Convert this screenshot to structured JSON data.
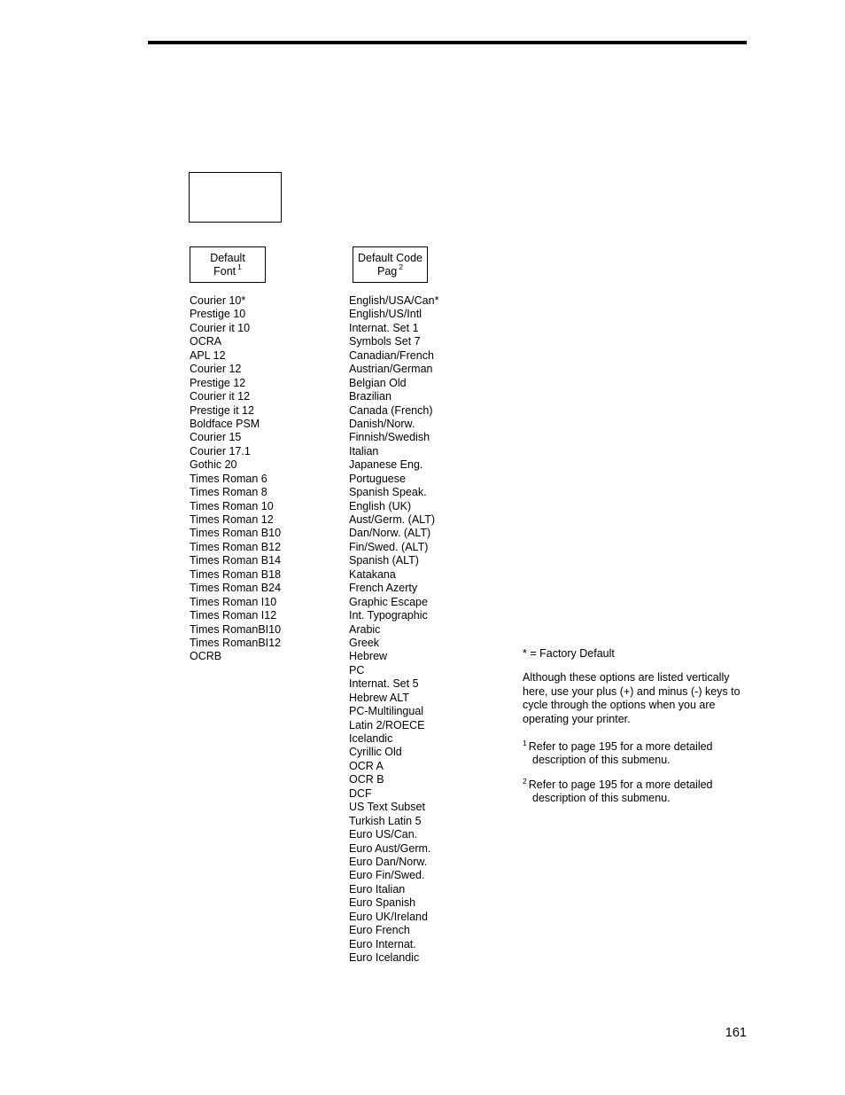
{
  "page": {
    "number": "161"
  },
  "menu_tree": {
    "parent_node": {
      "label": ""
    },
    "default_font_node": {
      "line1": "Default",
      "line2": "Font",
      "footnote_mark": "1"
    },
    "default_code_page_node": {
      "line1": "Default Code",
      "line2": "Pag",
      "footnote_mark": "2"
    }
  },
  "font_options": [
    "Courier 10*",
    "Prestige 10",
    "Courier it 10",
    "OCRA",
    "APL 12",
    "Courier 12",
    "Prestige 12",
    "Courier it 12",
    "Prestige it 12",
    "Boldface PSM",
    "Courier 15",
    "Courier 17.1",
    "Gothic 20",
    "Times Roman 6",
    "Times Roman 8",
    "Times Roman 10",
    "Times Roman 12",
    "Times Roman B10",
    "Times Roman B12",
    "Times Roman B14",
    "Times Roman B18",
    "Times Roman B24",
    "Times Roman I10",
    "Times Roman I12",
    "Times RomanBI10",
    "Times RomanBI12",
    "OCRB"
  ],
  "code_page_options": [
    "English/USA/Can*",
    "English/US/Intl",
    "Internat. Set 1",
    "Symbols Set 7",
    "Canadian/French",
    "Austrian/German",
    "Belgian Old",
    "Brazilian",
    "Canada (French)",
    "Danish/Norw.",
    "Finnish/Swedish",
    "Italian",
    "Japanese Eng.",
    "Portuguese",
    "Spanish Speak.",
    "English (UK)",
    "Aust/Germ. (ALT)",
    "Dan/Norw. (ALT)",
    "Fin/Swed. (ALT)",
    "Spanish (ALT)",
    "Katakana",
    "French Azerty",
    "Graphic Escape",
    "Int. Typographic",
    "Arabic",
    "Greek",
    "Hebrew",
    "PC",
    "Internat. Set 5",
    "Hebrew ALT",
    "PC-Multilingual",
    "Latin 2/ROECE",
    "Icelandic",
    "Cyrillic Old",
    "OCR A",
    "OCR B",
    "DCF",
    "US Text Subset",
    "Turkish Latin 5",
    "Euro US/Can.",
    "Euro Aust/Germ.",
    "Euro Dan/Norw.",
    "Euro Fin/Swed.",
    "Euro Italian",
    "Euro Spanish",
    "Euro UK/Ireland",
    "Euro French",
    "Euro Internat.",
    "Euro Icelandic"
  ],
  "notes": {
    "factory_default": "* = Factory Default",
    "vertical_note": "Although these options are listed vertically here, use your plus (+) and minus (-) keys to cycle through the options when you are operating your printer.",
    "footnotes": [
      {
        "mark": "1",
        "text": "Refer to page 195 for a more detailed description of this submenu."
      },
      {
        "mark": "2",
        "text": "Refer to page 195 for a more detailed description of this submenu."
      }
    ]
  }
}
